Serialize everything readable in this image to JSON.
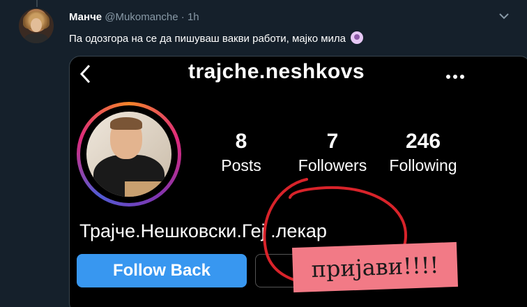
{
  "tweet": {
    "author_name": "Манче",
    "author_handle": "@Mukomanche",
    "separator": "·",
    "time": "1h",
    "text": "Па одозгора на се да пишуваш вакви работи, мајко мила"
  },
  "instagram": {
    "username": "trajche.neshkovs",
    "stats": [
      {
        "value": "8",
        "label": "Posts"
      },
      {
        "value": "7",
        "label": "Followers"
      },
      {
        "value": "246",
        "label": "Following"
      }
    ],
    "bio": "Трајче.Нешковски.Геј .лекар",
    "follow_back_label": "Follow Back",
    "sticker_text": "пријави!!!!"
  },
  "icons": {
    "caret": "chevron-down-icon",
    "back": "chevron-left-icon",
    "more": "more-dots-icon",
    "emoji": "woman-facepalming-emoji"
  },
  "colors": {
    "background": "#15202b",
    "muted_text": "#8899a6",
    "follow_button": "#3897f0",
    "scribble": "#d8232a",
    "sticker": "#f27a86"
  }
}
